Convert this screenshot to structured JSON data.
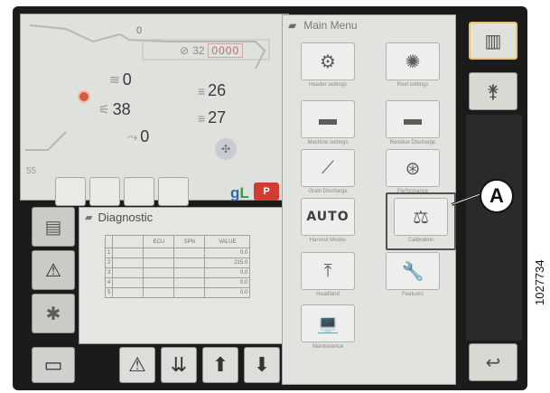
{
  "status": {
    "top_small": "0",
    "counter_value": "32",
    "counter_digits": "0000",
    "left_top": "0",
    "left_mid": "38",
    "left_bottom": "0",
    "right_top": "26",
    "right_mid": "27",
    "gauge_label": "55",
    "park_label": "P"
  },
  "diagnostic": {
    "title": "Diagnostic",
    "columns": [
      "",
      "",
      "ECU",
      "SPN",
      "VALUE"
    ],
    "rows": [
      {
        "idx": "1",
        "code": "",
        "ecu": "",
        "spn": "",
        "value": "0.0"
      },
      {
        "idx": "2",
        "code": "",
        "ecu": "",
        "spn": "",
        "value": "215.0"
      },
      {
        "idx": "3",
        "code": "",
        "ecu": "",
        "spn": "",
        "value": "0.0"
      },
      {
        "idx": "4",
        "code": "",
        "ecu": "",
        "spn": "",
        "value": "0.0"
      },
      {
        "idx": "5",
        "code": "",
        "ecu": "",
        "spn": "",
        "value": "0.0"
      }
    ]
  },
  "main_menu": {
    "title": "Main Menu",
    "items": [
      {
        "label": "Header settings",
        "icon": "header-settings-icon"
      },
      {
        "label": "Reel settings",
        "icon": "reel-icon"
      },
      {
        "label": "Machine settings",
        "icon": "combine-icon"
      },
      {
        "label": "Residue Discharge",
        "icon": "residue-icon"
      },
      {
        "label": "Grain Discharge",
        "icon": "grain-discharge-icon"
      },
      {
        "label": "Performance",
        "icon": "performance-icon"
      },
      {
        "label": "Harvest Modes",
        "icon": "auto-mode-icon",
        "text": "AUTO"
      },
      {
        "label": "Calibration",
        "icon": "scale-icon"
      },
      {
        "label": "Headland",
        "icon": "headland-icon"
      },
      {
        "label": "Features",
        "icon": "features-icon"
      },
      {
        "label": "Maintenance",
        "icon": "laptop-icon"
      }
    ]
  },
  "callout": {
    "letter": "A"
  },
  "figure_id": "1027734"
}
